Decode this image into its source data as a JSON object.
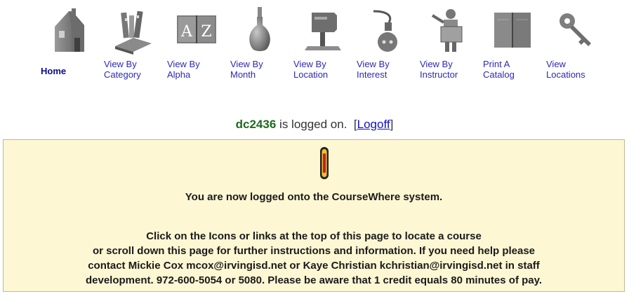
{
  "nav": {
    "items": [
      {
        "line1": "Home",
        "line2": "",
        "icon": "house-icon"
      },
      {
        "line1": "View By",
        "line2": "Category",
        "icon": "books-icon"
      },
      {
        "line1": "View By",
        "line2": "Alpha",
        "icon": "book-az-icon"
      },
      {
        "line1": "View By",
        "line2": "Month",
        "icon": "light-bulb-icon"
      },
      {
        "line1": "View By",
        "line2": "Location",
        "icon": "signpost-icon"
      },
      {
        "line1": "View By",
        "line2": "Interest",
        "icon": "plug-icon"
      },
      {
        "line1": "View By",
        "line2": "Instructor",
        "icon": "instructor-icon"
      },
      {
        "line1": "Print A",
        "line2": "Catalog",
        "icon": "open-book-icon"
      },
      {
        "line1": "View",
        "line2": "Locations",
        "icon": "key-icon"
      }
    ]
  },
  "status": {
    "username": "dc2436",
    "text": " is logged on.",
    "bracket_open": "[",
    "logoff_label": "Logoff",
    "bracket_close": "]"
  },
  "panel": {
    "message": "You are now logged onto the CourseWhere system.",
    "instructions": [
      "Click on the Icons or links at the top of this page to locate a course",
      "or scroll down this page for further instructions and information. If you need help please",
      "contact Mickie Cox mcox@irvingisd.net or Kaye Christian kchristian@irvingisd.net in staff",
      "development. 972-600-5054 or 5080. Please be aware that 1 credit equals 80 minutes of pay."
    ]
  }
}
